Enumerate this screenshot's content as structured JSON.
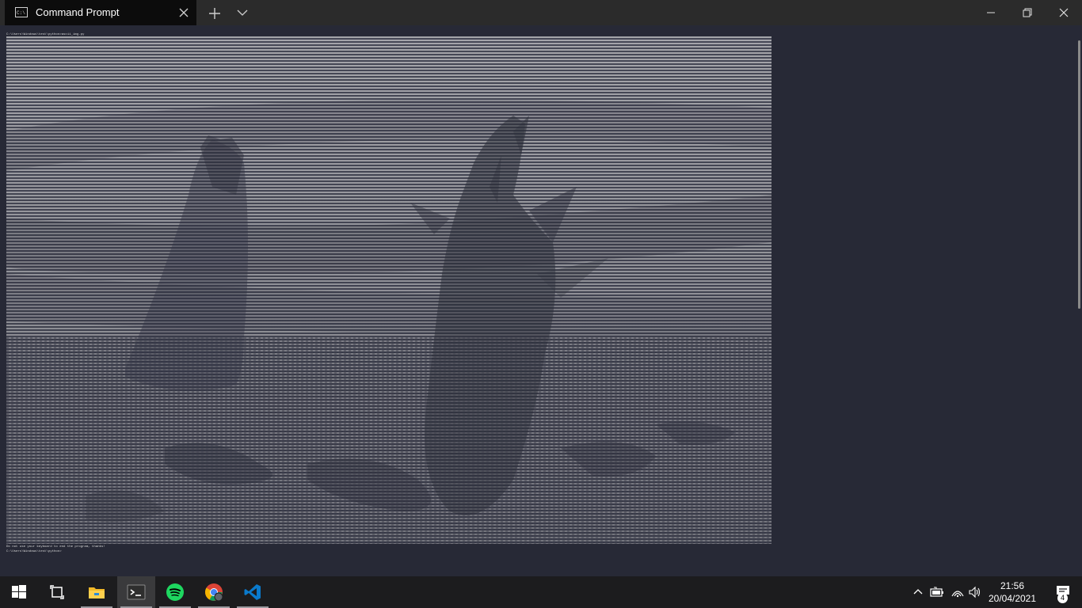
{
  "window": {
    "tab_title": "Command Prompt",
    "tab_icon": "command-prompt-icon"
  },
  "terminal": {
    "prompt_top": "C:\\Users\\Windows\\test\\python>ascii_img.py",
    "message": "Do not use your keyboard to end the program, thanks!",
    "prompt_bottom": "C:\\Users\\Windows\\test\\python>",
    "content_description_icon": "ascii-art-image"
  },
  "taskbar": {
    "apps": [
      "start-icon",
      "task-view-icon",
      "file-explorer-icon",
      "terminal-icon",
      "spotify-icon",
      "chrome-icon",
      "vscode-icon"
    ],
    "time": "21:56",
    "date": "20/04/2021",
    "notification_count": "4",
    "tray_icons": [
      "chevron-up-icon",
      "battery-icon",
      "wifi-icon",
      "volume-icon",
      "action-center-icon"
    ]
  },
  "colors": {
    "terminal_bg": "#272936",
    "titlebar_bg": "#2b2b2b",
    "taskbar_bg": "#1c1c1e",
    "ascii_light": "#a9a9ad",
    "ascii_dark": "#3a3c4a"
  }
}
